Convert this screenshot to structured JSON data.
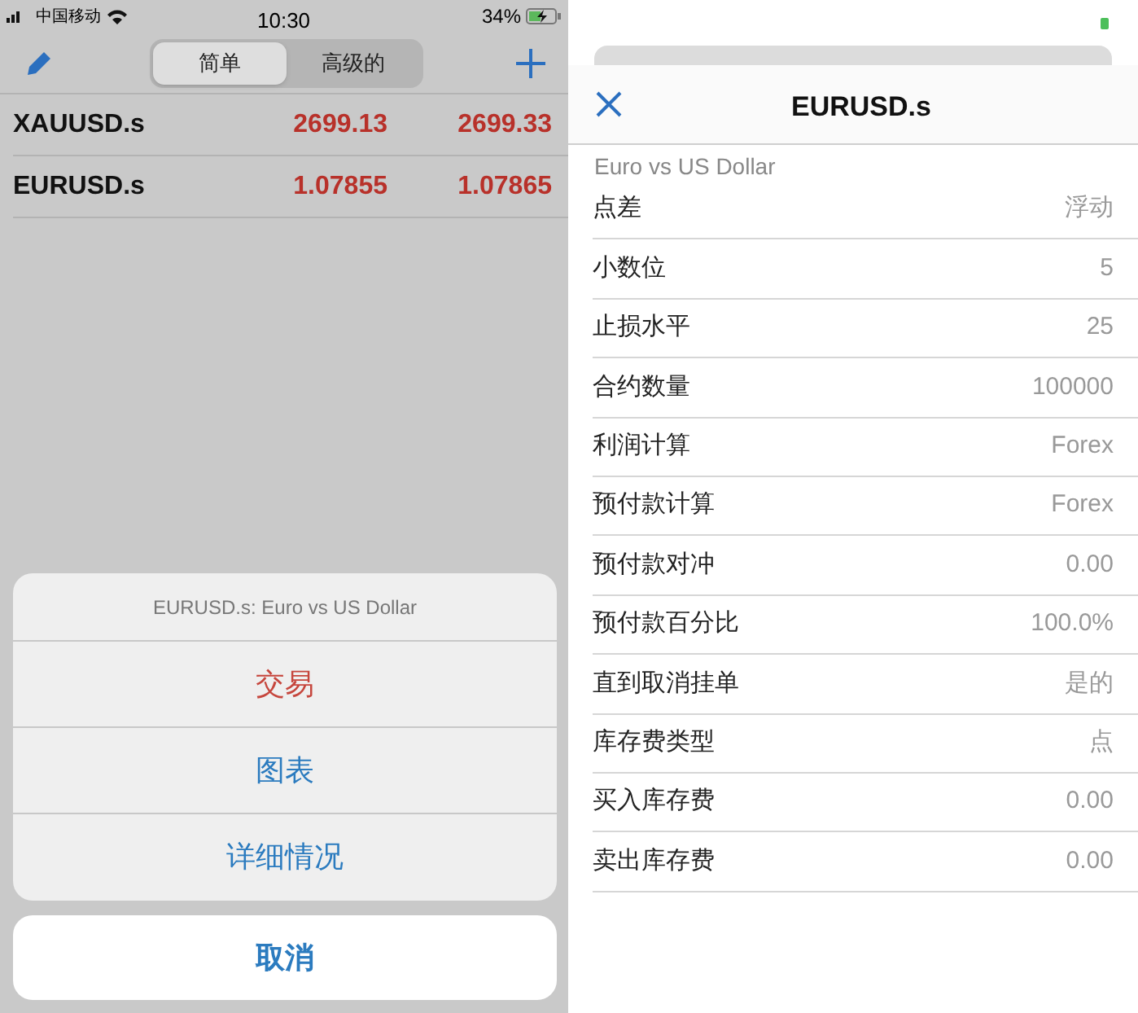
{
  "left": {
    "status_bar": {
      "carrier": "中国移动",
      "time": "10:30",
      "battery": "34%"
    },
    "segments": [
      {
        "label": "简单",
        "selected": true
      },
      {
        "label": "高级的",
        "selected": false
      }
    ],
    "quotes": [
      {
        "symbol": "XAUUSD.s",
        "bid": "2699.13",
        "ask": "2699.33"
      },
      {
        "symbol": "EURUSD.s",
        "bid": "1.07855",
        "ask": "1.07865"
      }
    ],
    "action_sheet": {
      "title": "EURUSD.s: Euro vs US Dollar",
      "actions": [
        {
          "label": "交易",
          "color": "#c6463d"
        },
        {
          "label": "图表",
          "color": "#2b7bbf"
        },
        {
          "label": "详细情况",
          "color": "#2b7bbf"
        }
      ],
      "cancel": "取消"
    }
  },
  "right": {
    "title": "EURUSD.s",
    "subtitle": "Euro vs US Dollar",
    "rows": [
      {
        "label": "点差",
        "value": "浮动"
      },
      {
        "label": "小数位",
        "value": "5"
      },
      {
        "label": "止损水平",
        "value": "25"
      },
      {
        "label": "合约数量",
        "value": "100000"
      },
      {
        "label": "利润计算",
        "value": "Forex"
      },
      {
        "label": "预付款计算",
        "value": "Forex"
      },
      {
        "label": "预付款对冲",
        "value": "0.00"
      },
      {
        "label": "预付款百分比",
        "value": "100.0%"
      },
      {
        "label": "直到取消挂单",
        "value": "是的"
      },
      {
        "label": "库存费类型",
        "value": "点"
      },
      {
        "label": "买入库存费",
        "value": "0.00"
      },
      {
        "label": "卖出库存费",
        "value": "0.00"
      }
    ]
  }
}
